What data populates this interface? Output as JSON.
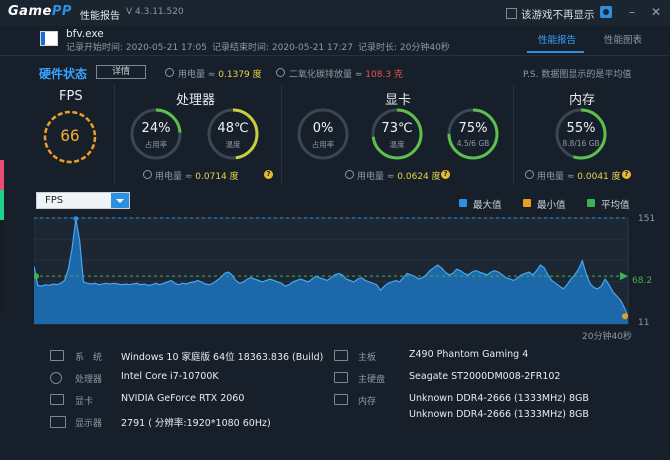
{
  "app": {
    "logo_main": "Game",
    "logo_accent": "PP",
    "title": "性能报告",
    "version": "V 4.3.11.520",
    "no_show_label": "该游戏不再显示"
  },
  "process": {
    "name": "bfv.exe",
    "record_start": "记录开始时间: 2020-05-21 17:05",
    "record_end": "记录结束时间: 2020-05-21 17:27",
    "record_duration": "记录时长: 20分钟40秒"
  },
  "tabs": [
    {
      "label": "性能报告",
      "active": true
    },
    {
      "label": "性能图表",
      "active": false
    }
  ],
  "hardware": {
    "title": "硬件状态",
    "detail_label": "详情",
    "total_power_label": "用电量 ≈",
    "total_power_value": "0.1379 度",
    "co2_label": "二氧化碳排放量 ≈",
    "co2_value": "108.3 克",
    "note": "P.S. 数据图显示的是平均值"
  },
  "fps": {
    "title": "FPS",
    "value": "66"
  },
  "cpu": {
    "title": "处理器",
    "usage_value": "24%",
    "usage_label": "占用率",
    "usage_level": 0.24,
    "temp_value": "48℃",
    "temp_label": "温度",
    "temp_level": 0.48,
    "power_label": "用电量 ≈",
    "power_value": "0.0714 度"
  },
  "gpu": {
    "title": "显卡",
    "usage_value": "0%",
    "usage_label": "占用率",
    "usage_level": 0.0,
    "temp_value": "73℃",
    "temp_label": "温度",
    "temp_level": 0.73,
    "mem_value": "75%",
    "mem_label": "4.5/6 GB",
    "mem_level": 0.75,
    "power_label": "用电量 ≈",
    "power_value": "0.0624 度"
  },
  "memory": {
    "title": "内存",
    "usage_value": "55%",
    "usage_label": "8.8/16 GB",
    "usage_level": 0.55,
    "power_label": "用电量 ≈",
    "power_value": "0.0041 度"
  },
  "chart_controls": {
    "metric_selected": "FPS",
    "legend_max": "最大值",
    "legend_min": "最小值",
    "legend_avg": "平均值",
    "colors": {
      "max": "#2d8fe0",
      "min": "#e8a020",
      "avg": "#3cb34a",
      "area": "#1e6cb0"
    }
  },
  "chart_data": {
    "type": "area",
    "title": "",
    "xlabel": "",
    "ylabel": "",
    "x_end_label": "20分钟40秒",
    "max_value": 151,
    "avg_value": 68.2,
    "min_value": 11,
    "ylim": [
      0,
      160
    ],
    "series": [
      {
        "name": "FPS",
        "values": [
          82,
          55,
          54,
          56,
          55,
          57,
          56,
          58,
          62,
          78,
          108,
          150,
          118,
          60,
          58,
          57,
          58,
          56,
          57,
          58,
          57,
          58,
          57,
          56,
          57,
          56,
          57,
          58,
          56,
          57,
          55,
          56,
          58,
          56,
          58,
          60,
          62,
          58,
          56,
          58,
          57,
          59,
          60,
          62,
          60,
          57,
          56,
          58,
          62,
          66,
          72,
          74,
          70,
          62,
          58,
          60,
          64,
          66,
          64,
          62,
          60,
          62,
          64,
          62,
          60,
          58,
          54,
          56,
          60,
          62,
          64,
          62,
          60,
          64,
          68,
          66,
          64,
          62,
          66,
          70,
          72,
          70,
          64,
          62,
          60,
          64,
          66,
          62,
          60,
          58,
          56,
          48,
          54,
          58,
          60,
          62,
          60,
          66,
          72,
          70,
          68,
          64,
          66,
          70,
          76,
          80,
          84,
          80,
          74,
          70,
          72,
          78,
          76,
          72,
          70,
          74,
          76,
          74,
          72,
          70,
          74,
          76,
          74,
          70,
          66,
          64,
          62,
          66,
          70,
          72,
          74,
          70,
          76,
          84,
          80,
          70,
          62,
          58,
          54,
          50,
          56,
          64,
          70,
          78,
          90,
          72,
          58,
          52,
          50,
          54,
          64,
          56,
          46,
          40,
          34,
          24,
          11
        ]
      }
    ]
  },
  "system_info": {
    "os_label": "系　统",
    "os_value": "Windows 10 家庭版 64位   18363.836 (Build)",
    "cpu_label": "处理器",
    "cpu_value": "Intel Core i7-10700K",
    "gpu_label": "显卡",
    "gpu_value": "NVIDIA GeForce RTX 2060",
    "display_label": "显示器",
    "display_value": "2791 ( 分辨率:1920*1080 60Hz)",
    "board_label": "主板",
    "board_value": "Z490 Phantom Gaming 4",
    "disk_label": "主硬盘",
    "disk_value": "Seagate ST2000DM008-2FR102",
    "mem_label": "内存",
    "mem_value_1": "Unknown DDR4-2666 (1333MHz) 8GB",
    "mem_value_2": "Unknown DDR4-2666 (1333MHz) 8GB"
  }
}
